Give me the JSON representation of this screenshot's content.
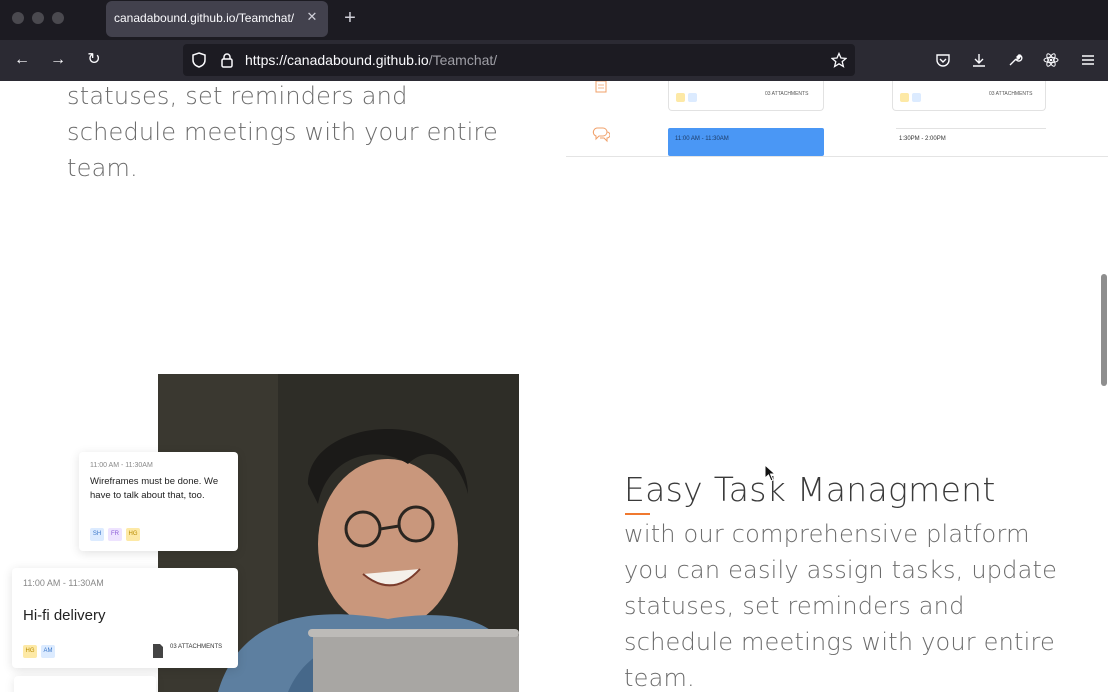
{
  "browser": {
    "tab_title": "canadabound.github.io/Teamchat/",
    "url_host": "https://canadabound.github.io",
    "url_path": "/Teamchat/"
  },
  "top_section": {
    "text": "statuses, set reminders and schedule meetings with your entire team.",
    "mock": {
      "attachments_label": "03 ATTACHMENTS",
      "slot_blue": "11:00 AM - 11:30AM",
      "slot_white": "1:30PM - 2:00PM"
    }
  },
  "cards": {
    "message": {
      "time": "11:00 AM - 11:30AM",
      "text": "Wireframes must be done. We have to talk about that, too.",
      "tags": [
        "SH",
        "FR",
        "HG"
      ]
    },
    "task": {
      "time": "11:00 AM - 11:30AM",
      "title": "Hi-fi delivery",
      "tags": [
        "HG",
        "AM"
      ],
      "attachments": "03 ATTACHMENTS"
    }
  },
  "feature": {
    "heading": "Easy Task Managment",
    "text": "with our comprehensive platform you can easily assign tasks, update statuses, set reminders and schedule meetings with your entire team.",
    "accent_color": "#f0792f"
  }
}
